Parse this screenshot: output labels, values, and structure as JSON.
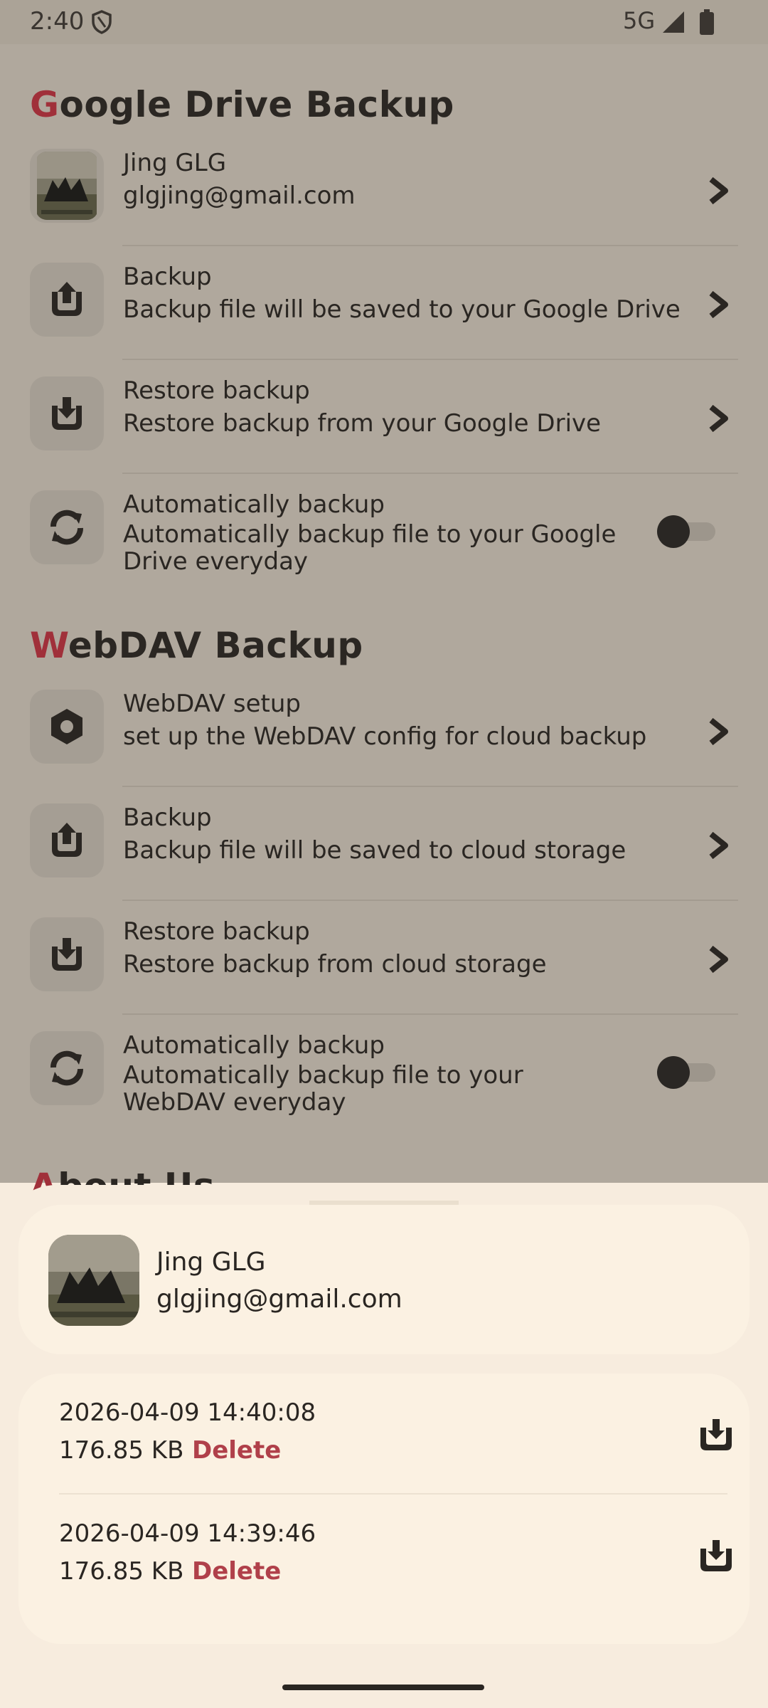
{
  "status_bar": {
    "time": "2:40",
    "network": "5G"
  },
  "google_drive": {
    "title_first": "G",
    "title_rest": "oogle Drive Backup",
    "account": {
      "name": "Jing GLG",
      "email": "glgjing@gmail.com"
    },
    "backup": {
      "title": "Backup",
      "subtitle": "Backup file will be saved to your Google Drive"
    },
    "restore": {
      "title": "Restore backup",
      "subtitle": "Restore backup from your Google Drive"
    },
    "auto": {
      "title": "Automatically backup",
      "subtitle": "Automatically backup file to your Google Drive everyday",
      "enabled": false
    }
  },
  "webdav": {
    "title_first": "W",
    "title_rest": "ebDAV Backup",
    "setup": {
      "title": "WebDAV setup",
      "subtitle": "set up the WebDAV config for cloud backup"
    },
    "backup": {
      "title": "Backup",
      "subtitle": "Backup file will be saved to cloud storage"
    },
    "restore": {
      "title": "Restore backup",
      "subtitle": "Restore backup from cloud storage"
    },
    "auto": {
      "title": "Automatically backup",
      "subtitle": "Automatically backup file to your WebDAV everyday",
      "enabled": false
    }
  },
  "about": {
    "title_first": "A",
    "title_rest": "bout Us"
  },
  "sheet": {
    "account": {
      "name": "Jing GLG",
      "email": "glgjing@gmail.com"
    },
    "files": [
      {
        "date": "2026-04-09 14:40:08",
        "size": "176.85 KB",
        "delete_label": "Delete"
      },
      {
        "date": "2026-04-09 14:39:46",
        "size": "176.85 KB",
        "delete_label": "Delete"
      }
    ]
  },
  "colors": {
    "accent": "#a0303a",
    "delete": "#b0404a",
    "dim_background": "#b0a89d",
    "sheet_background": "#f7ecde"
  }
}
